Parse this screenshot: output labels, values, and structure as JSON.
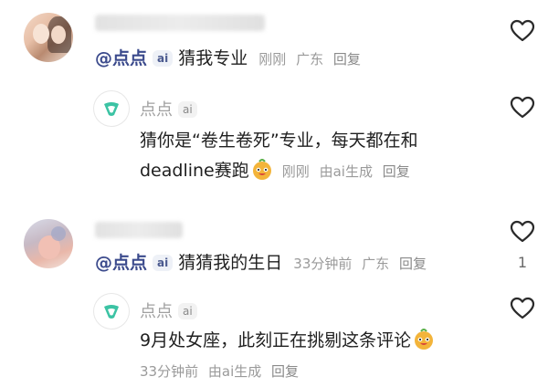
{
  "comments": [
    {
      "text": "猜我专业",
      "time": "刚刚",
      "location": "广东",
      "reply_label": "回复",
      "mention": "@点点",
      "ai_badge": "ai",
      "replies": [
        {
          "name": "点点",
          "ai_badge": "ai",
          "lines": [
            "猜你是“卷生卷死”专业，每天都在和",
            "deadline赛跑"
          ],
          "time": "刚刚",
          "generated": "由ai生成",
          "reply_label": "回复"
        }
      ]
    },
    {
      "text": "猜猜我的生日",
      "time": "33分钟前",
      "location": "广东",
      "reply_label": "回复",
      "mention": "@点点",
      "ai_badge": "ai",
      "likes": "1",
      "replies": [
        {
          "name": "点点",
          "ai_badge": "ai",
          "lines": [
            "9月处女座，此刻正在挑剔这条评论"
          ],
          "time": "33分钟前",
          "generated": "由ai生成",
          "reply_label": "回复"
        }
      ]
    }
  ],
  "icons": {
    "like": "heart-outline-icon",
    "ai_avatar": "ai-logo-icon",
    "emoji": "smiling-mascot-emoji"
  },
  "colors": {
    "mention": "#3b4a8c",
    "meta": "#9a9a9a",
    "ai_logo": "#3cc3a4"
  }
}
